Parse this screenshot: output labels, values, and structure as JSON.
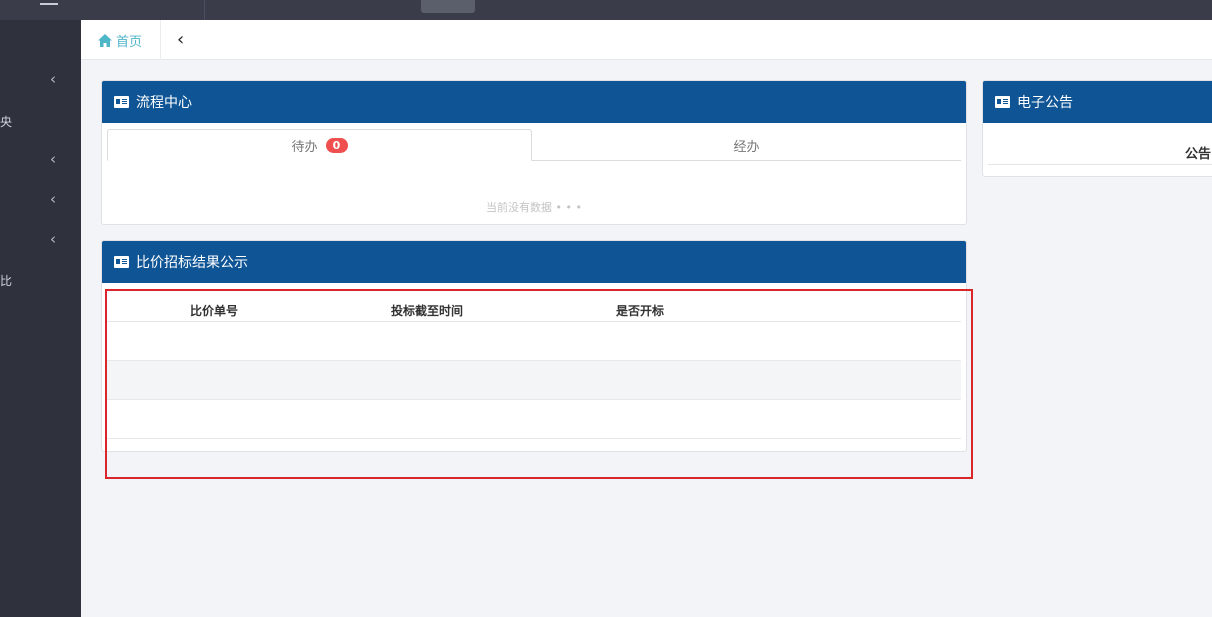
{
  "breadcrumb": {
    "home_label": "首页"
  },
  "flow_panel": {
    "title": "流程中心",
    "tabs": [
      {
        "label": "待办",
        "badge": "0"
      },
      {
        "label": "经办"
      }
    ],
    "empty_text": "当前没有数据 • • •"
  },
  "notice_panel": {
    "title": "电子公告",
    "header_text": "公告"
  },
  "bid_panel": {
    "title": "比价招标结果公示",
    "columns": [
      "比价单号",
      "投标截至时间",
      "是否开标"
    ]
  },
  "sidebar": {
    "fragments": [
      "央",
      "比"
    ]
  },
  "colors": {
    "panel_header": "#0f5596",
    "sidebar": "#2f323d",
    "badge": "#ef4f4f",
    "highlight": "#d9262b"
  },
  "icons": [
    "menu-icon",
    "home-icon",
    "back-arrow-icon",
    "chevron-left-icon",
    "card-icon"
  ]
}
